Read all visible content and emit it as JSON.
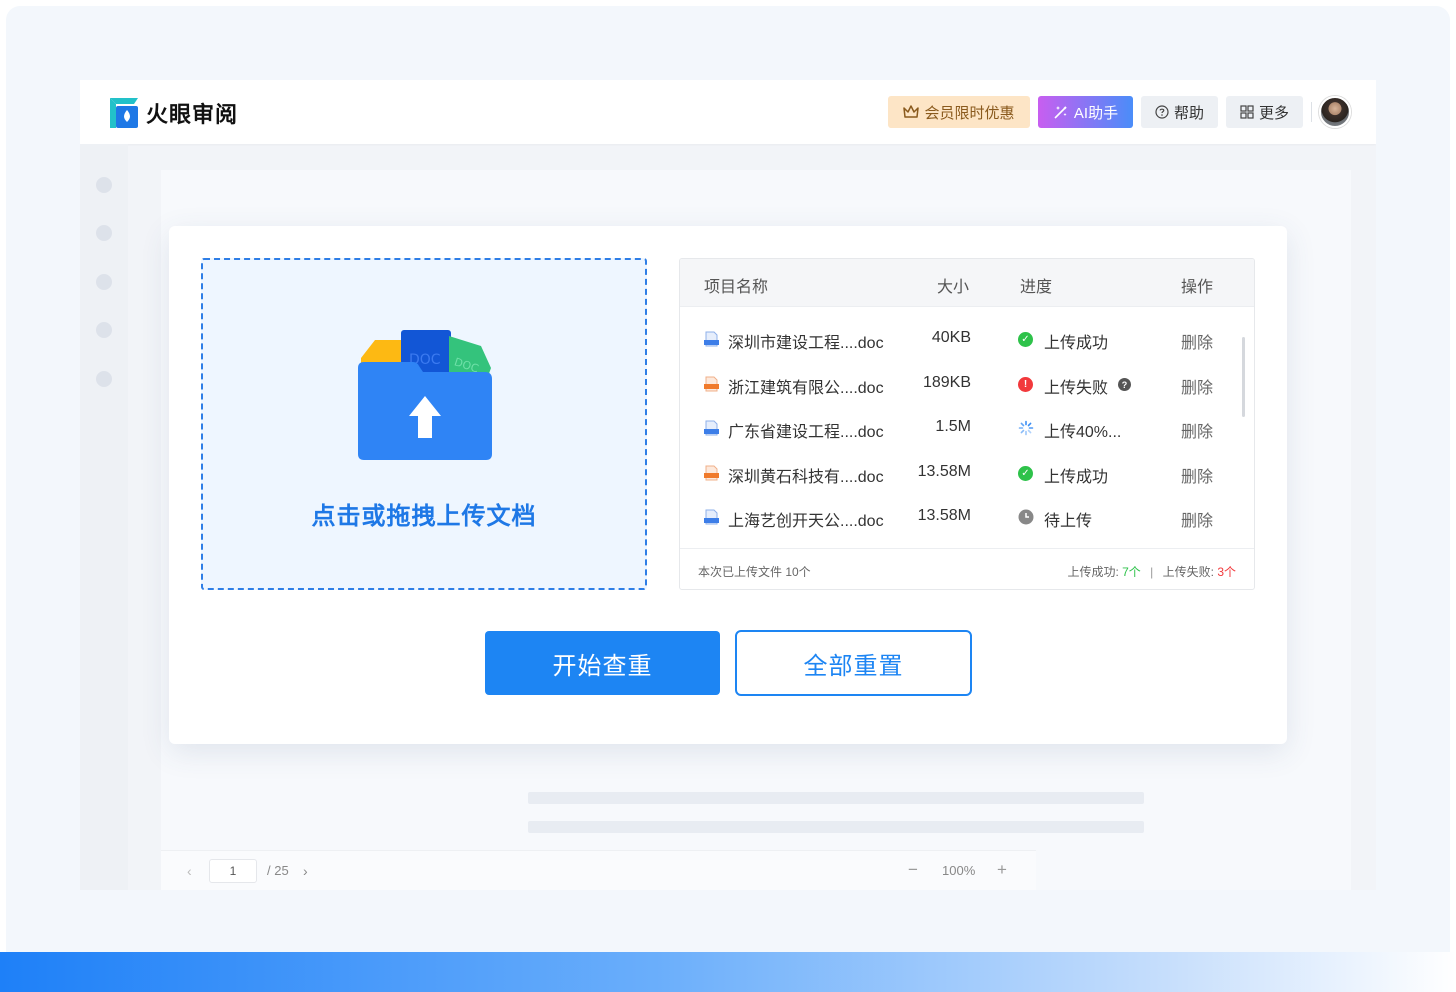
{
  "header": {
    "logo_text": "火眼审阅",
    "vip_label": "会员限时优惠",
    "ai_label": "AI助手",
    "help_label": "帮助",
    "more_label": "更多"
  },
  "upload": {
    "drop_text": "点击或拖拽上传文档"
  },
  "table": {
    "columns": {
      "name": "项目名称",
      "size": "大小",
      "progress": "进度",
      "action": "操作"
    },
    "rows": [
      {
        "name": "深圳市建设工程....doc",
        "size": "40KB",
        "status": "上传成功",
        "status_type": "success",
        "action": "删除",
        "file_type": "word"
      },
      {
        "name": "浙江建筑有限公....doc",
        "size": "189KB",
        "status": "上传失败",
        "status_type": "error",
        "action": "删除",
        "file_type": "pdf"
      },
      {
        "name": "广东省建设工程....doc",
        "size": "1.5M",
        "status": "上传40%...",
        "status_type": "loading",
        "action": "删除",
        "file_type": "word"
      },
      {
        "name": "深圳黄石科技有....doc",
        "size": "13.58M",
        "status": "上传成功",
        "status_type": "success",
        "action": "删除",
        "file_type": "pdf"
      },
      {
        "name": "上海艺创开天公....doc",
        "size": "13.58M",
        "status": "待上传",
        "status_type": "pending",
        "action": "删除",
        "file_type": "word"
      }
    ],
    "footer": {
      "uploaded_text": "本次已上传文件 10个",
      "success_label": "上传成功:",
      "success_count": "7个",
      "separator": "|",
      "fail_label": "上传失败:",
      "fail_count": "3个"
    }
  },
  "actions": {
    "start_label": "开始查重",
    "reset_label": "全部重置"
  },
  "pager": {
    "page": "1",
    "total": "/ 25",
    "zoom": "100%"
  },
  "colors": {
    "primary": "#1d85f3",
    "success": "#2ec24a",
    "error": "#f2393c",
    "pending": "#888888",
    "vip_bg": "#fde5c6"
  },
  "icons": [
    "crown-icon",
    "wand-icon",
    "help-icon",
    "grid-icon",
    "folder-upload-icon",
    "word-file-icon",
    "pdf-file-icon",
    "check-circle-icon",
    "error-circle-icon",
    "loading-icon",
    "clock-icon",
    "question-icon",
    "chevron-left-icon",
    "chevron-right-icon",
    "minus-icon",
    "plus-icon"
  ]
}
